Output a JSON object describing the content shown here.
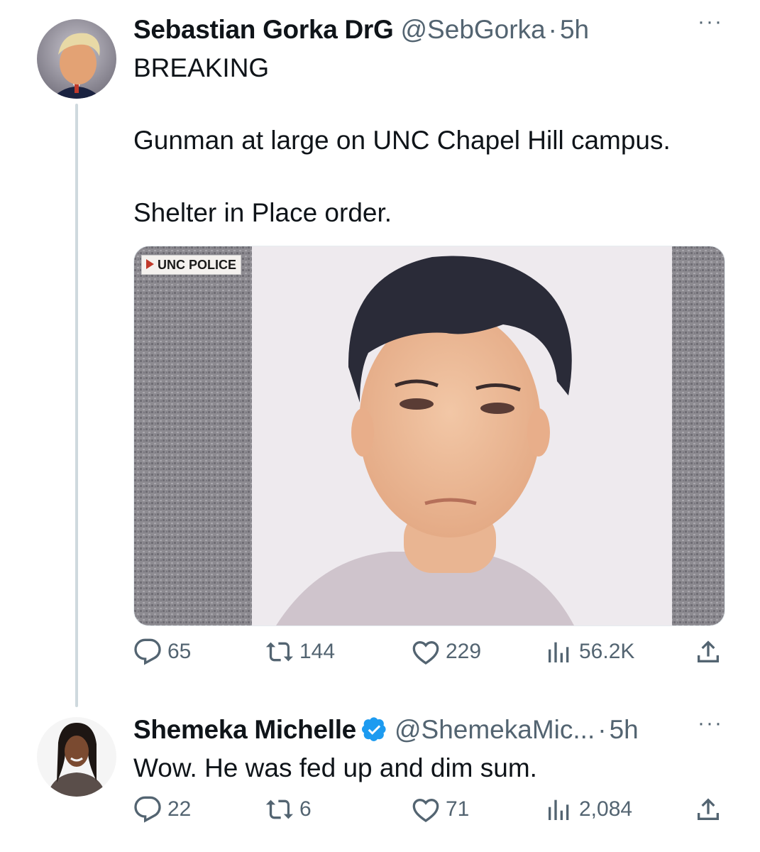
{
  "tweet": {
    "author_name": "Sebastian Gorka DrG",
    "handle": "@SebGorka",
    "separator": "·",
    "time": "5h",
    "more": "···",
    "lines": [
      "BREAKING",
      "Gunman at large on UNC Chapel Hill campus.",
      "Shelter in Place order."
    ],
    "media_caption": "UNC POLICE",
    "stats": {
      "replies": "65",
      "retweets": "144",
      "likes": "229",
      "views": "56.2K"
    }
  },
  "reply": {
    "author_name": "Shemeka Michelle",
    "verified": true,
    "handle": "@ShemekaMic...",
    "separator": "·",
    "time": "5h",
    "more": "···",
    "text": "Wow. He was fed up and dim sum.",
    "stats": {
      "replies": "22",
      "retweets": "6",
      "likes": "71",
      "views": "2,084"
    }
  },
  "colors": {
    "text": "#0f1419",
    "secondary": "#536471",
    "verified": "#1d9bf0",
    "thread_line": "#cfd9de"
  },
  "icons": [
    "reply-icon",
    "retweet-icon",
    "like-icon",
    "views-icon",
    "share-icon",
    "more-icon",
    "verified-badge-icon"
  ]
}
